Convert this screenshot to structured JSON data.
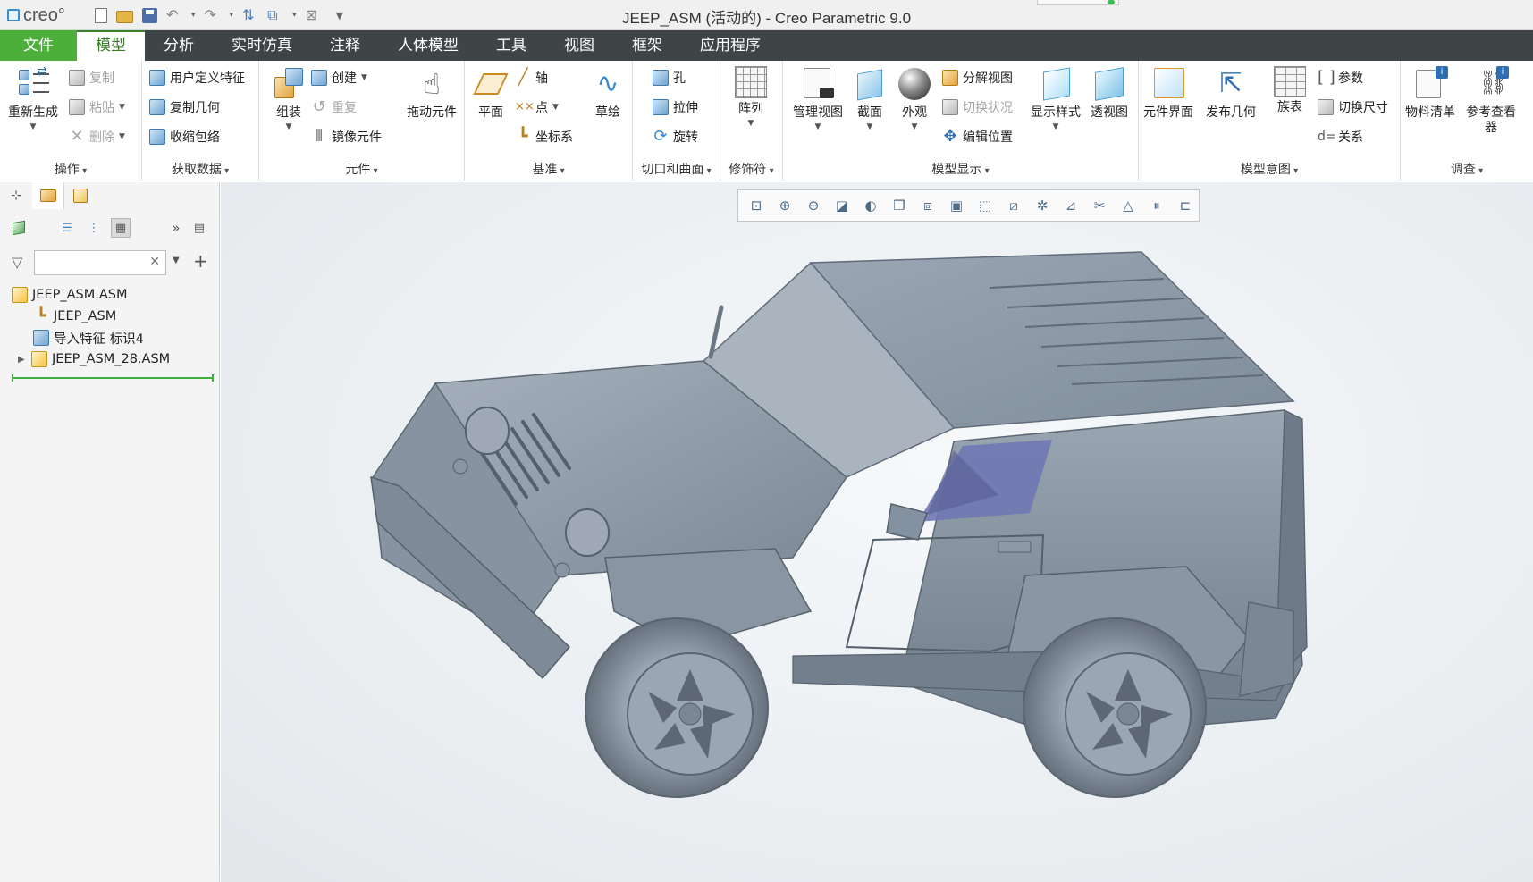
{
  "window": {
    "app_logo": "creo°",
    "title": "JEEP_ASM (活动的) - Creo Parametric 9.0"
  },
  "tabs": [
    {
      "label": "文件",
      "kind": "file"
    },
    {
      "label": "模型",
      "kind": "active"
    },
    {
      "label": "分析"
    },
    {
      "label": "实时仿真"
    },
    {
      "label": "注释"
    },
    {
      "label": "人体模型"
    },
    {
      "label": "工具"
    },
    {
      "label": "视图"
    },
    {
      "label": "框架"
    },
    {
      "label": "应用程序"
    }
  ],
  "ribbon": {
    "groups": {
      "operations": {
        "label": "操作",
        "regenerate": "重新生成",
        "copy": "复制",
        "paste": "粘贴",
        "delete": "删除"
      },
      "get_data": {
        "label": "获取数据",
        "udf": "用户定义特征",
        "copy_geometry": "复制几何",
        "shrinkwrap": "收缩包络"
      },
      "component": {
        "label": "元件",
        "assemble": "组装",
        "create": "创建",
        "repeat": "重复",
        "mirror_component": "镜像元件",
        "drag_components": "拖动元件"
      },
      "datum": {
        "label": "基准",
        "plane": "平面",
        "axis": "轴",
        "point": "点",
        "csys": "坐标系",
        "sketch": "草绘"
      },
      "cut_surface": {
        "label": "切口和曲面",
        "hole": "孔",
        "extrude": "拉伸",
        "revolve": "旋转"
      },
      "modifiers": {
        "label": "修饰符",
        "pattern": "阵列"
      },
      "model_display": {
        "label": "模型显示",
        "manage_views": "管理视图",
        "section": "截面",
        "appearance": "外观",
        "explode_view": "分解视图",
        "toggle_status": "切换状况",
        "edit_position": "编辑位置",
        "display_style": "显示样式",
        "perspective": "透视图"
      },
      "model_intent": {
        "label": "模型意图",
        "component_interface": "元件界面",
        "publish_geometry": "发布几何",
        "family_table": "族表",
        "parameters": "参数",
        "switch_dimensions": "切换尺寸",
        "relations": "关系"
      },
      "investigate": {
        "label": "调查",
        "bom": "物料清单",
        "reference_viewer": "参考查看器"
      }
    }
  },
  "model_tree": {
    "search_placeholder": "",
    "items": [
      {
        "label": "JEEP_ASM.ASM",
        "icon": "assembly-icon",
        "level": 0
      },
      {
        "label": "JEEP_ASM",
        "icon": "csys-icon",
        "level": 1
      },
      {
        "label": "导入特征 标识4",
        "icon": "import-feature-icon",
        "level": 1
      },
      {
        "label": "JEEP_ASM_28.ASM",
        "icon": "assembly-icon",
        "level": 1,
        "expandable": true
      }
    ]
  },
  "graphics_toolbar": {
    "icons": [
      "refit-icon",
      "zoom-in-icon",
      "zoom-out-icon",
      "repaint-icon",
      "display-style-icon",
      "saved-orientations-icon",
      "view-manager-icon",
      "spin-center-icon",
      "perspective-icon",
      "datum-display-icon",
      "annotation-display-icon",
      "section-icon",
      "explode-icon",
      "appearance-icon",
      "pause-icon",
      "regen-icon"
    ]
  },
  "colors": {
    "tab_bar": "#3f4447",
    "file_tab": "#4caf3a",
    "active_tab_text": "#3a7d2a",
    "model_body": "#8b98a6",
    "model_glass": "#6f78b4"
  }
}
